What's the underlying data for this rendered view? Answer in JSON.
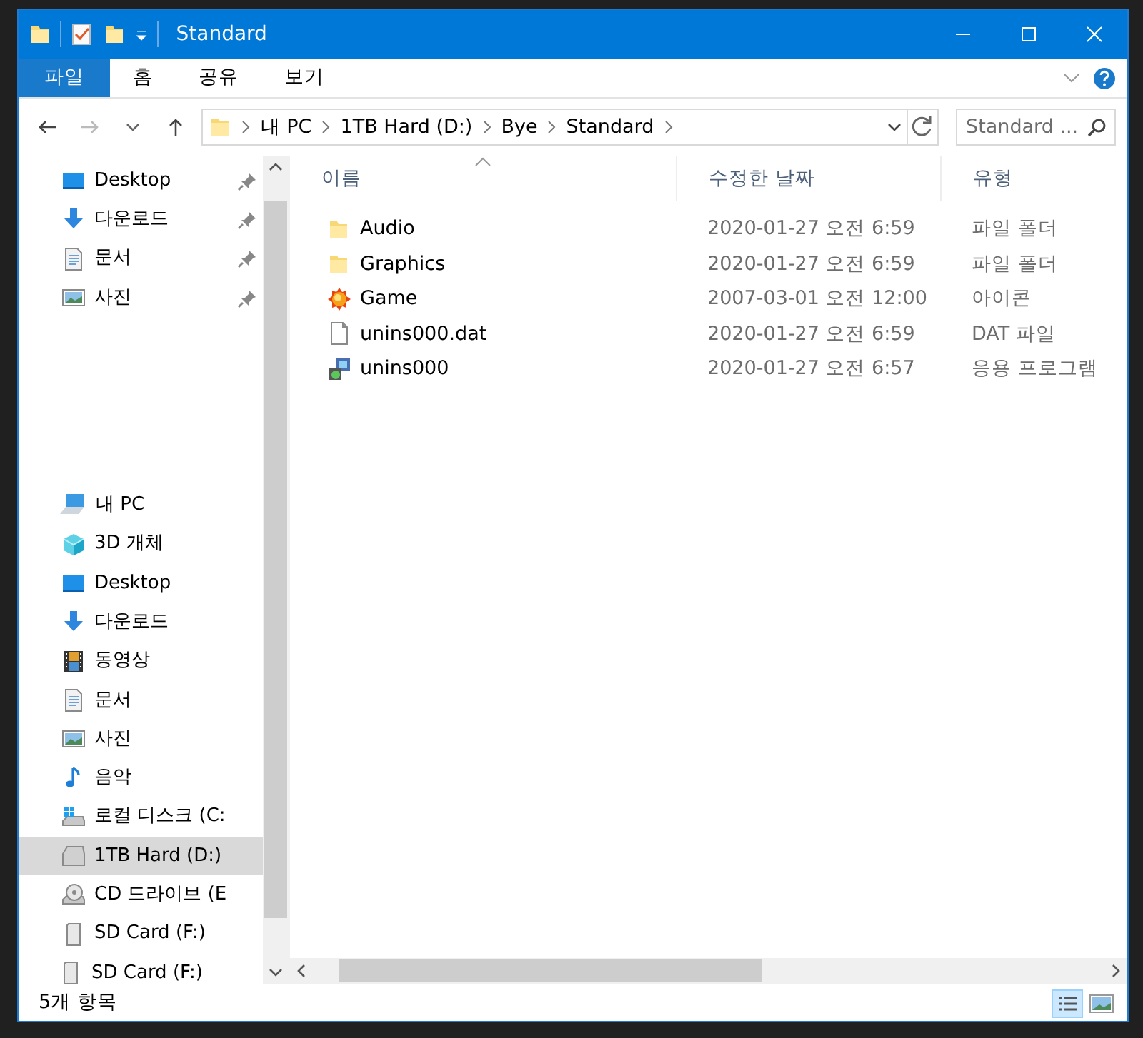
{
  "window": {
    "title": "Standard"
  },
  "ribbon_tabs": [
    {
      "label": "파일",
      "selected": true
    },
    {
      "label": "홈",
      "selected": false
    },
    {
      "label": "공유",
      "selected": false
    },
    {
      "label": "보기",
      "selected": false
    }
  ],
  "address_bar": {
    "breadcrumb": [
      "내 PC",
      "1TB Hard (D:)",
      "Bye",
      "Standard"
    ]
  },
  "search": {
    "placeholder": "Standard ..."
  },
  "sidebar": {
    "quick_access": [
      {
        "label": "Desktop",
        "kind": "desktop",
        "pinned": true
      },
      {
        "label": "다운로드",
        "kind": "download",
        "pinned": true
      },
      {
        "label": "문서",
        "kind": "document",
        "pinned": true
      },
      {
        "label": "사진",
        "kind": "picture",
        "pinned": true
      }
    ],
    "this_pc": {
      "label": "내 PC",
      "children": [
        {
          "label": "3D 개체",
          "kind": "cube",
          "selected": false
        },
        {
          "label": "Desktop",
          "kind": "desktop",
          "selected": false
        },
        {
          "label": "다운로드",
          "kind": "download",
          "selected": false
        },
        {
          "label": "동영상",
          "kind": "video",
          "selected": false
        },
        {
          "label": "문서",
          "kind": "document",
          "selected": false
        },
        {
          "label": "사진",
          "kind": "picture",
          "selected": false
        },
        {
          "label": "음악",
          "kind": "music",
          "selected": false
        },
        {
          "label": "로컬 디스크 (C:",
          "kind": "system-drive",
          "selected": false
        },
        {
          "label": "1TB Hard (D:)",
          "kind": "drive",
          "selected": true
        },
        {
          "label": "CD 드라이브 (E",
          "kind": "cd",
          "selected": false
        },
        {
          "label": "SD Card (F:)",
          "kind": "card",
          "selected": false
        }
      ]
    },
    "extra": [
      {
        "label": "SD Card (F:)",
        "kind": "card"
      }
    ]
  },
  "table": {
    "columns": [
      {
        "label": "이름",
        "sorted": true
      },
      {
        "label": "수정한 날짜",
        "sorted": false
      },
      {
        "label": "유형",
        "sorted": false
      }
    ],
    "rows": [
      {
        "name": "Audio",
        "kind": "folder",
        "date": "2020-01-27 오전 6:59",
        "type": "파일 폴더"
      },
      {
        "name": "Graphics",
        "kind": "folder",
        "date": "2020-01-27 오전 6:59",
        "type": "파일 폴더"
      },
      {
        "name": "Game",
        "kind": "icon",
        "date": "2007-03-01 오전 12:00",
        "type": "아이콘"
      },
      {
        "name": "unins000.dat",
        "kind": "file",
        "date": "2020-01-27 오전 6:59",
        "type": "DAT 파일"
      },
      {
        "name": "unins000",
        "kind": "setup",
        "date": "2020-01-27 오전 6:57",
        "type": "응용 프로그램"
      }
    ]
  },
  "status_bar": {
    "count": "5개 항목",
    "views": [
      {
        "kind": "details",
        "selected": true
      },
      {
        "kind": "large-icons",
        "selected": false
      }
    ]
  }
}
